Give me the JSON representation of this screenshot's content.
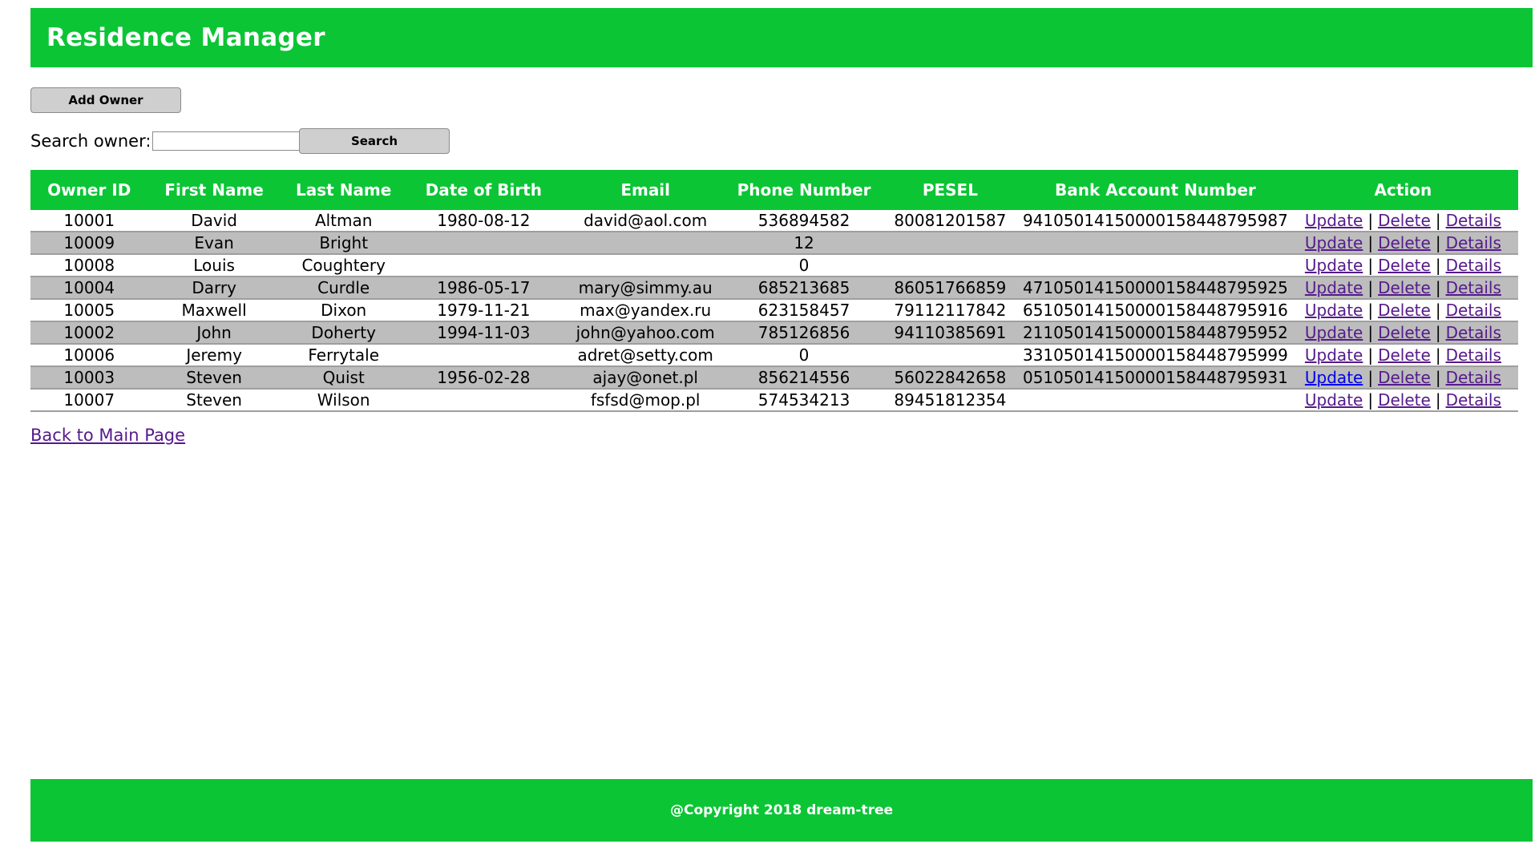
{
  "header": {
    "title": "Residence Manager"
  },
  "toolbar": {
    "add_owner_label": "Add Owner"
  },
  "search": {
    "label": "Search owner:",
    "value": "",
    "button_label": "Search"
  },
  "table": {
    "columns": [
      "Owner ID",
      "First Name",
      "Last Name",
      "Date of Birth",
      "Email",
      "Phone Number",
      "PESEL",
      "Bank Account Number",
      "Action"
    ],
    "actions": {
      "update": "Update",
      "delete": "Delete",
      "details": "Details",
      "separator": "|"
    },
    "rows": [
      {
        "id": "10001",
        "first": "David",
        "last": "Altman",
        "dob": "1980-08-12",
        "email": "david@aol.com",
        "phone": "536894582",
        "pesel": "80081201587",
        "bank": "94105014150000158448795987"
      },
      {
        "id": "10009",
        "first": "Evan",
        "last": "Bright",
        "dob": "",
        "email": "",
        "phone": "12",
        "pesel": "",
        "bank": ""
      },
      {
        "id": "10008",
        "first": "Louis",
        "last": "Coughtery",
        "dob": "",
        "email": "",
        "phone": "0",
        "pesel": "",
        "bank": ""
      },
      {
        "id": "10004",
        "first": "Darry",
        "last": "Curdle",
        "dob": "1986-05-17",
        "email": "mary@simmy.au",
        "phone": "685213685",
        "pesel": "86051766859",
        "bank": "47105014150000158448795925"
      },
      {
        "id": "10005",
        "first": "Maxwell",
        "last": "Dixon",
        "dob": "1979-11-21",
        "email": "max@yandex.ru",
        "phone": "623158457",
        "pesel": "79112117842",
        "bank": "65105014150000158448795916"
      },
      {
        "id": "10002",
        "first": "John",
        "last": "Doherty",
        "dob": "1994-11-03",
        "email": "john@yahoo.com",
        "phone": "785126856",
        "pesel": "94110385691",
        "bank": "21105014150000158448795952"
      },
      {
        "id": "10006",
        "first": "Jeremy",
        "last": "Ferrytale",
        "dob": "",
        "email": "adret@setty.com",
        "phone": "0",
        "pesel": "",
        "bank": "33105014150000158448795999"
      },
      {
        "id": "10003",
        "first": "Steven",
        "last": "Quist",
        "dob": "1956-02-28",
        "email": "ajay@onet.pl",
        "phone": "856214556",
        "pesel": "56022842658",
        "bank": "05105014150000158448795931"
      },
      {
        "id": "10007",
        "first": "Steven",
        "last": "Wilson",
        "dob": "",
        "email": "fsfsd@mop.pl",
        "phone": "574534213",
        "pesel": "89451812354",
        "bank": ""
      }
    ]
  },
  "links": {
    "back": "Back to Main Page"
  },
  "footer": {
    "copyright": "@Copyright 2018 dream-tree"
  },
  "colors": {
    "brand_green": "#0bc535",
    "row_alt": "#bdbdbd",
    "visited_link": "#551a8b",
    "active_link": "#0000ee"
  }
}
